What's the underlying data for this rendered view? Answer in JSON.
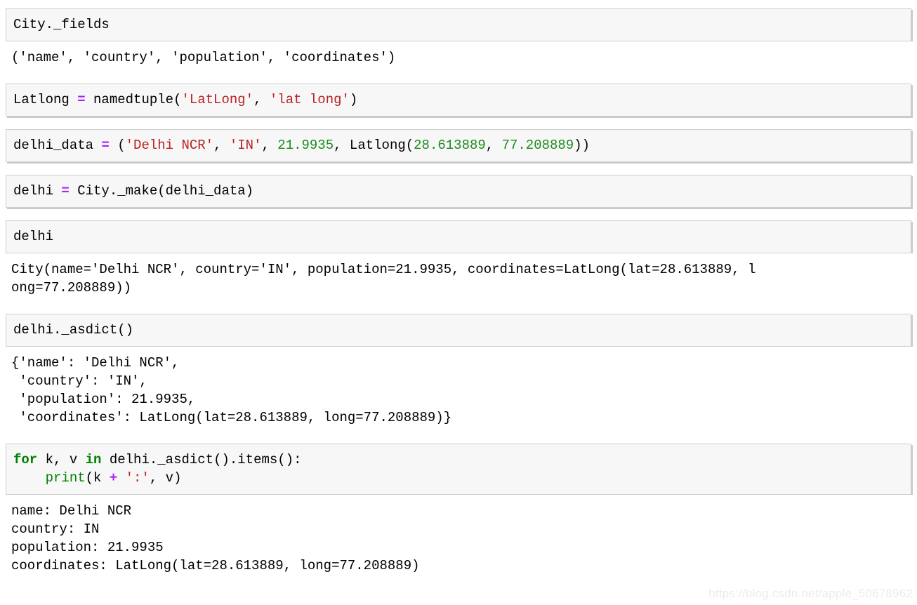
{
  "notebook": {
    "kind": "jupyter-notebook-cells",
    "background": "#ffffff",
    "cell_background": "#f7f7f7",
    "cell_border": "#cfcfcf",
    "colors": {
      "operator": "#aa22ff",
      "string": "#ba2121",
      "number": "#1d8a1d",
      "keyword": "#008000",
      "builtin": "#008000",
      "text": "#000000",
      "watermark": "#e9ecef"
    },
    "cells": [
      {
        "id": "cell-1",
        "input_lines": [
          [
            {
              "t": "City._fields",
              "c": "plain"
            }
          ]
        ],
        "output_lines": [
          [
            {
              "t": "(",
              "c": "plain"
            },
            {
              "t": "'name', 'country', 'population', 'coordinates'",
              "c": "plain"
            },
            {
              "t": ")",
              "c": "plain"
            }
          ]
        ]
      },
      {
        "id": "cell-2",
        "input_lines": [
          [
            {
              "t": "Latlong ",
              "c": "plain"
            },
            {
              "t": "=",
              "c": "op"
            },
            {
              "t": " namedtuple(",
              "c": "plain"
            },
            {
              "t": "'LatLong'",
              "c": "str"
            },
            {
              "t": ", ",
              "c": "plain"
            },
            {
              "t": "'lat long'",
              "c": "str"
            },
            {
              "t": ")",
              "c": "plain"
            }
          ]
        ],
        "output_lines": []
      },
      {
        "id": "cell-3",
        "input_lines": [
          [
            {
              "t": "delhi_data ",
              "c": "plain"
            },
            {
              "t": "=",
              "c": "op"
            },
            {
              "t": " (",
              "c": "plain"
            },
            {
              "t": "'Delhi NCR'",
              "c": "str"
            },
            {
              "t": ", ",
              "c": "plain"
            },
            {
              "t": "'IN'",
              "c": "str"
            },
            {
              "t": ", ",
              "c": "plain"
            },
            {
              "t": "21.9935",
              "c": "num"
            },
            {
              "t": ", Latlong(",
              "c": "plain"
            },
            {
              "t": "28.613889",
              "c": "num"
            },
            {
              "t": ", ",
              "c": "plain"
            },
            {
              "t": "77.208889",
              "c": "num"
            },
            {
              "t": "))",
              "c": "plain"
            }
          ]
        ],
        "output_lines": []
      },
      {
        "id": "cell-4",
        "input_lines": [
          [
            {
              "t": "delhi ",
              "c": "plain"
            },
            {
              "t": "=",
              "c": "op"
            },
            {
              "t": " City._make(delhi_data)",
              "c": "plain"
            }
          ]
        ],
        "output_lines": []
      },
      {
        "id": "cell-5",
        "input_lines": [
          [
            {
              "t": "delhi",
              "c": "plain"
            }
          ]
        ],
        "output_lines": [
          [
            {
              "t": "City(name='Delhi NCR', country='IN', population=21.9935, coordinates=LatLong(lat=28.613889, l",
              "c": "plain"
            }
          ],
          [
            {
              "t": "ong=77.208889))",
              "c": "plain"
            }
          ]
        ]
      },
      {
        "id": "cell-6",
        "input_lines": [
          [
            {
              "t": "delhi._asdict()",
              "c": "plain"
            }
          ]
        ],
        "output_lines": [
          [
            {
              "t": "{'name': 'Delhi NCR',",
              "c": "plain"
            }
          ],
          [
            {
              "t": " 'country': 'IN',",
              "c": "plain"
            }
          ],
          [
            {
              "t": " 'population': 21.9935,",
              "c": "plain"
            }
          ],
          [
            {
              "t": " 'coordinates': LatLong(lat=28.613889, long=77.208889)}",
              "c": "plain"
            }
          ]
        ]
      },
      {
        "id": "cell-7",
        "input_lines": [
          [
            {
              "t": "for",
              "c": "kw"
            },
            {
              "t": " k, v ",
              "c": "plain"
            },
            {
              "t": "in",
              "c": "kw"
            },
            {
              "t": " delhi._asdict().items():",
              "c": "plain"
            }
          ],
          [
            {
              "t": "    ",
              "c": "plain"
            },
            {
              "t": "print",
              "c": "builtin"
            },
            {
              "t": "(k ",
              "c": "plain"
            },
            {
              "t": "+",
              "c": "op"
            },
            {
              "t": " ",
              "c": "plain"
            },
            {
              "t": "':'",
              "c": "str"
            },
            {
              "t": ", v)",
              "c": "plain"
            }
          ]
        ],
        "output_lines": [
          [
            {
              "t": "name: Delhi NCR",
              "c": "plain"
            }
          ],
          [
            {
              "t": "country: IN",
              "c": "plain"
            }
          ],
          [
            {
              "t": "population: 21.9935",
              "c": "plain"
            }
          ],
          [
            {
              "t": "coordinates: LatLong(lat=28.613889, long=77.208889)",
              "c": "plain"
            }
          ]
        ]
      }
    ]
  },
  "watermark": {
    "text": "https://blog.csdn.net/apple_50678962"
  }
}
